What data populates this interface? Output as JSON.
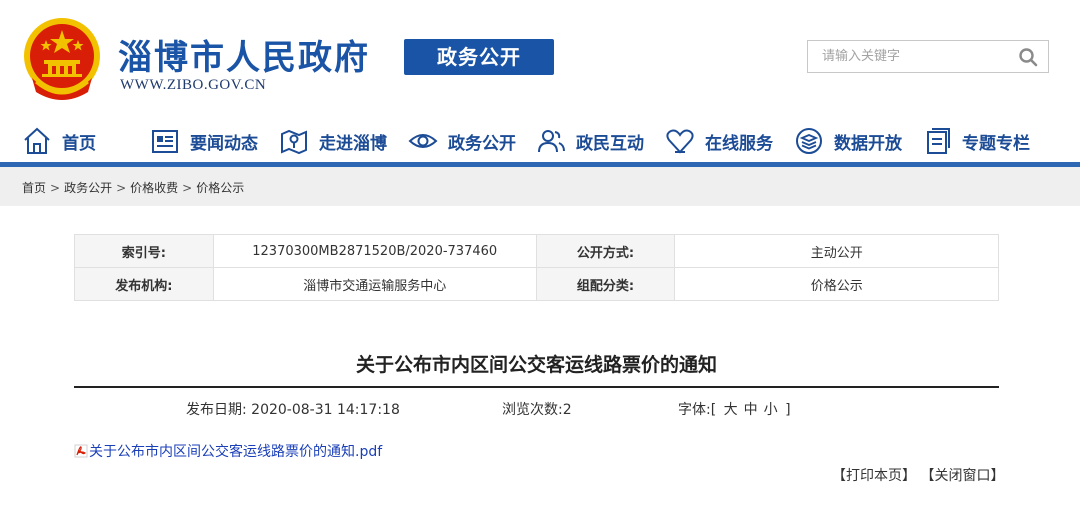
{
  "header": {
    "site_title": "淄博市人民政府",
    "site_url": "WWW.ZIBO.GOV.CN",
    "section_badge": "政务公开",
    "search_placeholder": "请输入关键字"
  },
  "nav": {
    "items": [
      {
        "label": "首页",
        "icon": "home-icon"
      },
      {
        "label": "要闻动态",
        "icon": "news-icon"
      },
      {
        "label": "走进淄博",
        "icon": "map-icon"
      },
      {
        "label": "政务公开",
        "icon": "eye-icon"
      },
      {
        "label": "政民互动",
        "icon": "people-icon"
      },
      {
        "label": "在线服务",
        "icon": "heart-icon"
      },
      {
        "label": "数据开放",
        "icon": "layers-icon"
      },
      {
        "label": "专题专栏",
        "icon": "document-icon"
      }
    ]
  },
  "breadcrumb": [
    "首页",
    "政务公开",
    "价格收费",
    "价格公示"
  ],
  "meta": {
    "index_label": "索引号:",
    "index_value": "12370300MB2871520B/2020-737460",
    "open_mode_label": "公开方式:",
    "open_mode_value": "主动公开",
    "publisher_label": "发布机构:",
    "publisher_value": "淄博市交通运输服务中心",
    "category_label": "组配分类:",
    "category_value": "价格公示"
  },
  "article": {
    "title": "关于公布市内区间公交客运线路票价的通知",
    "date_label": "发布日期:",
    "date_value": "2020-08-31 14:17:18",
    "views_label": "浏览次数:",
    "views_value": "2",
    "font_label": "字体:",
    "font_open": "[",
    "font_large": "大",
    "font_medium": "中",
    "font_small": "小",
    "font_close": "]",
    "attachment": "关于公布市内区间公交客运线路票价的通知.pdf"
  },
  "actions": {
    "print": "【打印本页】",
    "close": "【关闭窗口】"
  },
  "colors": {
    "brand_blue": "#1a54a6",
    "nav_text": "#1d4c96",
    "link_blue": "#1a3fb8",
    "emblem_red": "#d81e06",
    "emblem_gold": "#f2c200"
  }
}
